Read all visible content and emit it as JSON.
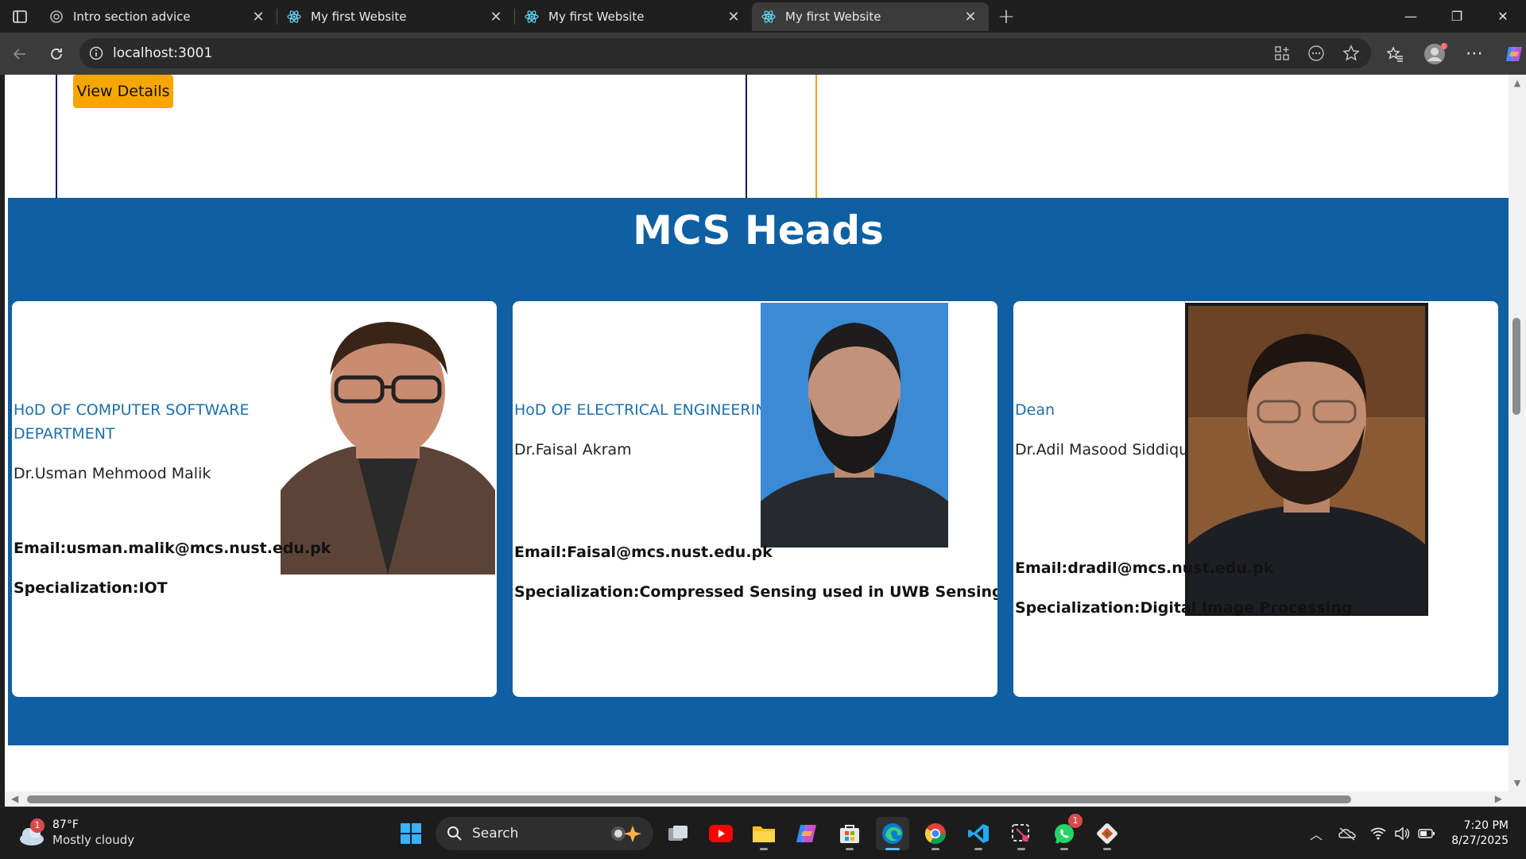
{
  "browser": {
    "tabs": [
      {
        "title": "Intro section advice",
        "favicon": "chatgpt-icon",
        "active": false
      },
      {
        "title": "My first Website",
        "favicon": "react-icon",
        "active": false
      },
      {
        "title": "My first Website",
        "favicon": "react-icon",
        "active": false
      },
      {
        "title": "My first Website",
        "favicon": "react-icon",
        "active": true
      }
    ],
    "url": "localhost:3001"
  },
  "page": {
    "view_details_label": "View Details",
    "section_title": "MCS Heads",
    "section_bg": "#0f5fa3",
    "people": [
      {
        "role": "HoD OF COMPUTER SOFTWARE DEPARTMENT",
        "name": "Dr.Usman Mehmood Malik",
        "email": "Email:usman.malik@mcs.nust.edu.pk",
        "specialization": "Specialization:IOT"
      },
      {
        "role": "HoD OF ELECTRICAL ENGINEERING",
        "name": "Dr.Faisal Akram",
        "email": "Email:Faisal@mcs.nust.edu.pk",
        "specialization": "Specialization:Compressed Sensing used in UWB Sensing"
      },
      {
        "role": "Dean",
        "name": "Dr.Adil Masood Siddiqui",
        "email": "Email:dradil@mcs.nust.edu.pk",
        "specialization": "Specialization:Digital Image Processing"
      }
    ]
  },
  "taskbar": {
    "weather": {
      "temp": "87°F",
      "condition": "Mostly cloudy",
      "badge": "1"
    },
    "search_label": "Search",
    "whatsapp_badge": "1",
    "time": "7:20 PM",
    "date": "8/27/2025"
  }
}
